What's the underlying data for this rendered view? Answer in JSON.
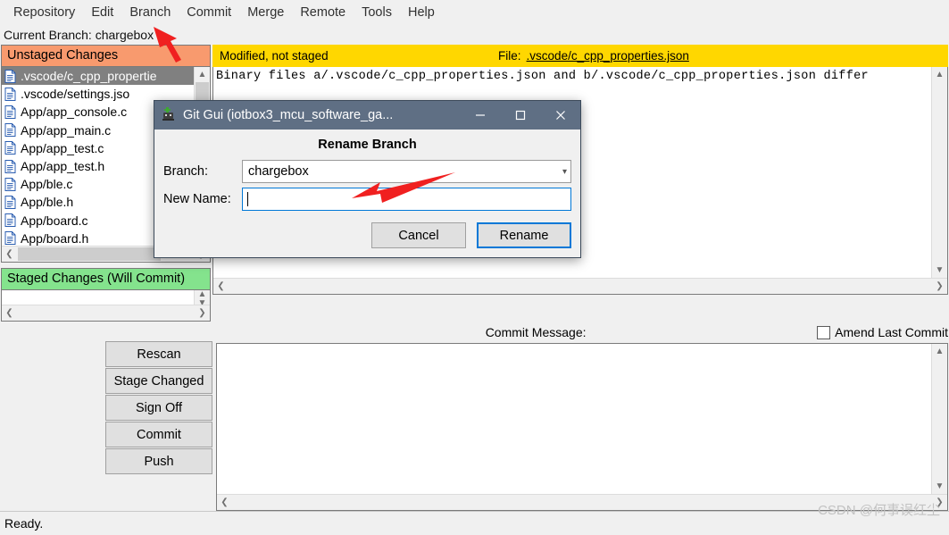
{
  "window": {
    "status_text": "Ready.",
    "watermark": "CSDN @何事误红尘"
  },
  "menubar": {
    "items": [
      {
        "label": "Repository"
      },
      {
        "label": "Edit"
      },
      {
        "label": "Branch"
      },
      {
        "label": "Commit"
      },
      {
        "label": "Merge"
      },
      {
        "label": "Remote"
      },
      {
        "label": "Tools"
      },
      {
        "label": "Help"
      }
    ]
  },
  "branch_bar": {
    "text": "Current Branch: chargebox"
  },
  "unstaged": {
    "title": "Unstaged Changes",
    "files": [
      {
        "name": ".vscode/c_cpp_propertie",
        "selected": true
      },
      {
        "name": ".vscode/settings.jso",
        "selected": false
      },
      {
        "name": "App/app_console.c",
        "selected": false
      },
      {
        "name": "App/app_main.c",
        "selected": false
      },
      {
        "name": "App/app_test.c",
        "selected": false
      },
      {
        "name": "App/app_test.h",
        "selected": false
      },
      {
        "name": "App/ble.c",
        "selected": false
      },
      {
        "name": "App/ble.h",
        "selected": false
      },
      {
        "name": "App/board.c",
        "selected": false
      },
      {
        "name": "App/board.h",
        "selected": false
      }
    ]
  },
  "staged": {
    "title": "Staged Changes (Will Commit)",
    "files": []
  },
  "diff": {
    "status": "Modified, not staged",
    "file_prefix": "File:",
    "file_name": ".vscode/c_cpp_properties.json",
    "content": "Binary files a/.vscode/c_cpp_properties.json and b/.vscode/c_cpp_properties.json differ",
    "header_bg": "#ffd700"
  },
  "actions": {
    "buttons": [
      {
        "label": "Rescan"
      },
      {
        "label": "Stage Changed"
      },
      {
        "label": "Sign Off"
      },
      {
        "label": "Commit"
      },
      {
        "label": "Push"
      }
    ]
  },
  "commit": {
    "label": "Commit Message:",
    "amend_label": "Amend Last Commit",
    "amend_checked": false,
    "message": ""
  },
  "dialog": {
    "title": "Git Gui (iotbox3_mcu_software_ga...",
    "icon": "git-gui-icon",
    "heading": "Rename Branch",
    "branch_label": "Branch:",
    "branch_value": "chargebox",
    "newname_label": "New Name:",
    "newname_value": "",
    "cancel_label": "Cancel",
    "rename_label": "Rename",
    "minimize": "minimize-icon",
    "maximize": "maximize-icon",
    "close": "close-icon",
    "titlebar_color": "#5f6f84",
    "accent": "#0078d7"
  }
}
